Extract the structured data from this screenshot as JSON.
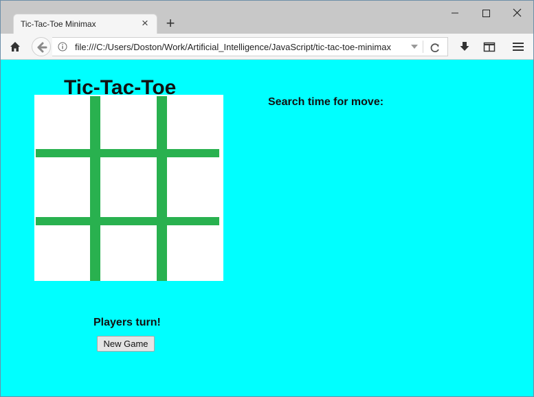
{
  "browser": {
    "tab_title": "Tic-Tac-Toe Minimax",
    "url": "file:///C:/Users/Doston/Work/Artificial_Intelligence/JavaScript/tic-tac-toe-minimax",
    "icons": {
      "tab_close": "close-icon",
      "new_tab": "plus-icon",
      "minimize": "minimize-icon",
      "maximize": "maximize-icon",
      "close": "close-icon",
      "home": "home-icon",
      "back": "back-arrow-icon",
      "info": "info-icon",
      "url_dropdown": "chevron-down-icon",
      "reload": "reload-icon",
      "downloads": "download-icon",
      "sidebar": "sidebar-icon",
      "menu": "menu-icon"
    },
    "tab_close_glyph": "×",
    "new_tab_glyph": "+"
  },
  "page": {
    "title": "Tic-Tac-Toe",
    "search_time_label": "Search time for move:",
    "turn_status": "Players turn!",
    "new_game_label": "New Game",
    "board": {
      "rows": 3,
      "cols": 3,
      "cells": [
        "",
        "",
        "",
        "",
        "",
        "",
        "",
        "",
        ""
      ]
    },
    "colors": {
      "background": "#00ffff",
      "grid_line": "#29b14f",
      "board_background": "#ffffff"
    }
  }
}
